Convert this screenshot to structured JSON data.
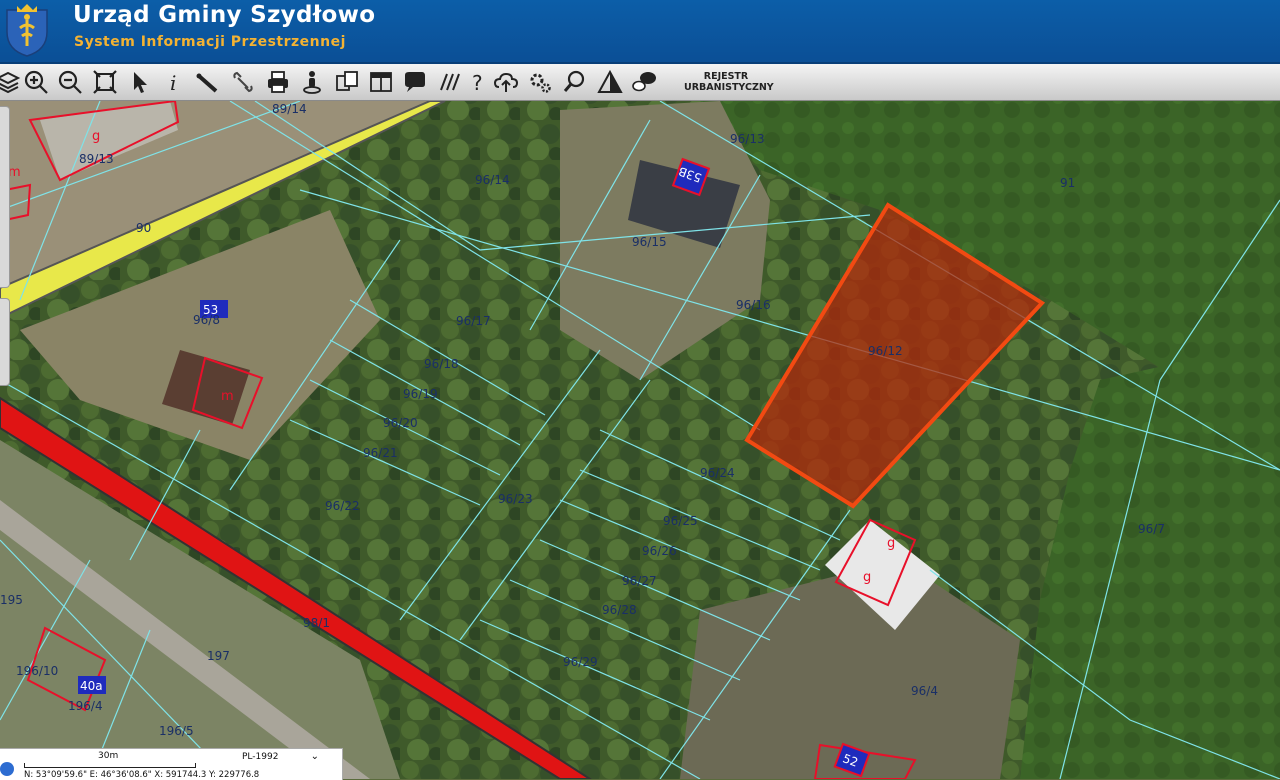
{
  "header": {
    "title": "Urząd Gminy Szydłowo",
    "subtitle": "System Informacji Przestrzennej",
    "colors": {
      "background": "#0c5ea8",
      "title": "#ffffff",
      "subtitle": "#f3b233"
    }
  },
  "toolbar": {
    "tools": [
      {
        "name": "layers-icon"
      },
      {
        "name": "zoom-in-icon"
      },
      {
        "name": "zoom-out-icon"
      },
      {
        "name": "zoom-extent-icon"
      },
      {
        "name": "select-pointer-icon"
      },
      {
        "name": "info-icon"
      },
      {
        "name": "measure-ruler-icon"
      },
      {
        "name": "link-icon"
      },
      {
        "name": "print-icon"
      },
      {
        "name": "street-view-icon"
      },
      {
        "name": "compare-icon"
      },
      {
        "name": "layout-icon"
      },
      {
        "name": "comment-icon"
      },
      {
        "name": "hatch-icon"
      },
      {
        "name": "help-icon"
      },
      {
        "name": "cloud-upload-icon"
      },
      {
        "name": "settings-icon"
      },
      {
        "name": "search-icon"
      },
      {
        "name": "warning-icon"
      },
      {
        "name": "chat-icon"
      }
    ],
    "rejestr_line1": "REJESTR",
    "rejestr_line2": "URBANISTYCZNY"
  },
  "map": {
    "selected_parcel": "96/12",
    "selected_color": "#e84a1c",
    "parcel_line_color": "#7fe3e8",
    "parcels": [
      "89/14",
      "89/13",
      "96/13",
      "91",
      "96/14",
      "96/15",
      "90",
      "96/16",
      "96/17",
      "96/8",
      "96/12",
      "96/18",
      "96/19",
      "96/20",
      "96/21",
      "96/24",
      "96/23",
      "96/22",
      "96/25",
      "96/7",
      "96/26",
      "96/27",
      "96/28",
      "98/1",
      "96/29",
      "195",
      "197",
      "196/10",
      "196/4",
      "96/4",
      "196/5"
    ],
    "house_numbers": [
      "53B",
      "53",
      "40a",
      "52"
    ],
    "building_marks": [
      "g",
      "m",
      "g",
      "m",
      "g"
    ]
  },
  "statusbar": {
    "scale_label": "30m",
    "crs": "PL-1992",
    "coords": "N: 53°09'59.6\" E: 46°36'08.6\" X: 591744.3 Y: 229776.8"
  }
}
